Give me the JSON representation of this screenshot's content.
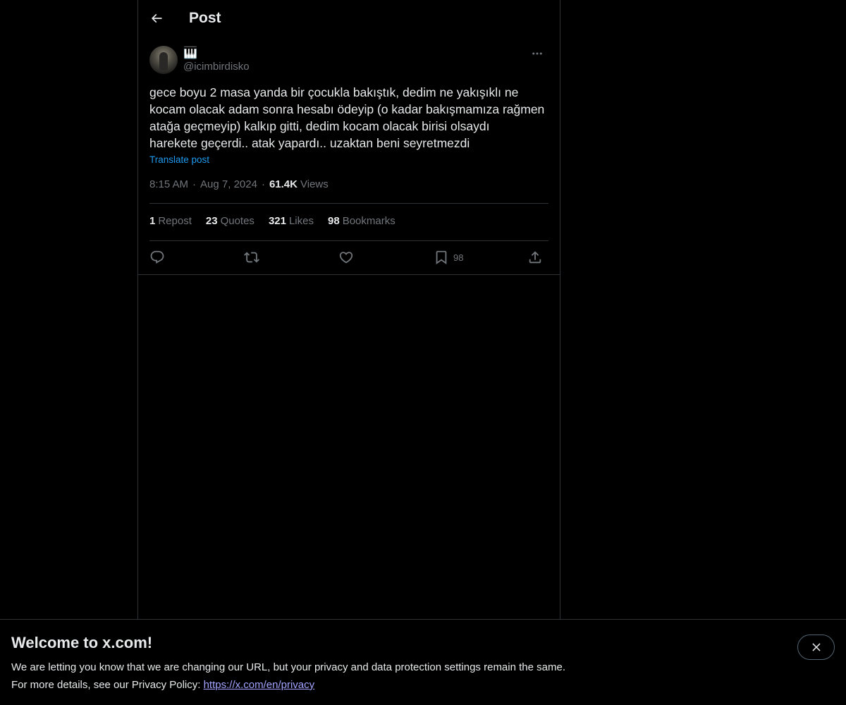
{
  "header": {
    "title": "Post"
  },
  "author": {
    "display_name": "🎹",
    "handle": "@icimbirdisko"
  },
  "post": {
    "text": "gece boyu 2 masa yanda bir çocukla bakıştık, dedim ne yakışıklı ne\nkocam olacak adam sonra hesabı ödeyip (o kadar bakışmamıza rağmen\natağa geçmeyip) kalkıp gitti, dedim kocam olacak birisi olsaydı\nharekete geçerdi.. atak yapardı.. uzaktan beni seyretmezdi",
    "translate_label": "Translate post",
    "time": "8:15 AM",
    "separator": "·",
    "date": "Aug 7, 2024",
    "views_count": "61.4K",
    "views_label": "Views"
  },
  "stats": {
    "reposts": {
      "count": "1",
      "label": "Repost"
    },
    "quotes": {
      "count": "23",
      "label": "Quotes"
    },
    "likes": {
      "count": "321",
      "label": "Likes"
    },
    "bookmarks": {
      "count": "98",
      "label": "Bookmarks"
    }
  },
  "actions": {
    "reply_icon": "reply-icon",
    "repost_icon": "repost-icon",
    "like_icon": "heart-icon",
    "bookmark_icon": "bookmark-icon",
    "bookmark_count": "98",
    "share_icon": "share-icon"
  },
  "banner": {
    "title": "Welcome to x.com!",
    "line1": "We are letting you know that we are changing our URL, but your privacy and data protection settings remain the same.",
    "line2_prefix": "For more details, see our Privacy Policy: ",
    "link": "https://x.com/en/privacy"
  },
  "colors": {
    "background": "#000000",
    "text": "#e7e9ea",
    "muted": "#71767b",
    "accent": "#1d9bf0",
    "border": "#2f3336"
  }
}
